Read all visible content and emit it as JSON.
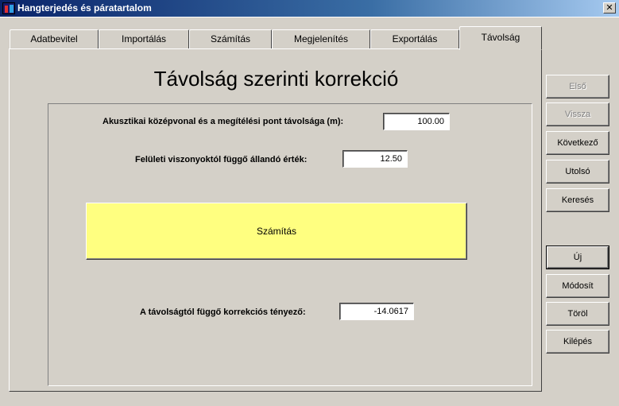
{
  "window": {
    "title": "Hangterjedés és páratartalom",
    "close_label": "✕"
  },
  "tabs": [
    {
      "label": "Adatbevitel"
    },
    {
      "label": "Importálás"
    },
    {
      "label": "Számítás"
    },
    {
      "label": "Megjelenítés"
    },
    {
      "label": "Exportálás"
    },
    {
      "label": "Távolság",
      "active": true
    }
  ],
  "panel": {
    "title": "Távolság szerinti korrekció",
    "distance_label": "Akusztikai középvonal és a megítélési pont távolsága (m):",
    "distance_value": "100.00",
    "constant_label": "Felületi viszonyoktól függő állandó érték:",
    "constant_value": "12.50",
    "calc_button": "Számítás",
    "result_label": "A távolságtól függő korrekciós tényező:",
    "result_value": "-14.0617"
  },
  "side_buttons": {
    "first": "Első",
    "back": "Vissza",
    "next": "Következő",
    "last": "Utolsó",
    "search": "Keresés",
    "new": "Új",
    "modify": "Módosít",
    "delete": "Töröl",
    "exit": "Kilépés"
  }
}
